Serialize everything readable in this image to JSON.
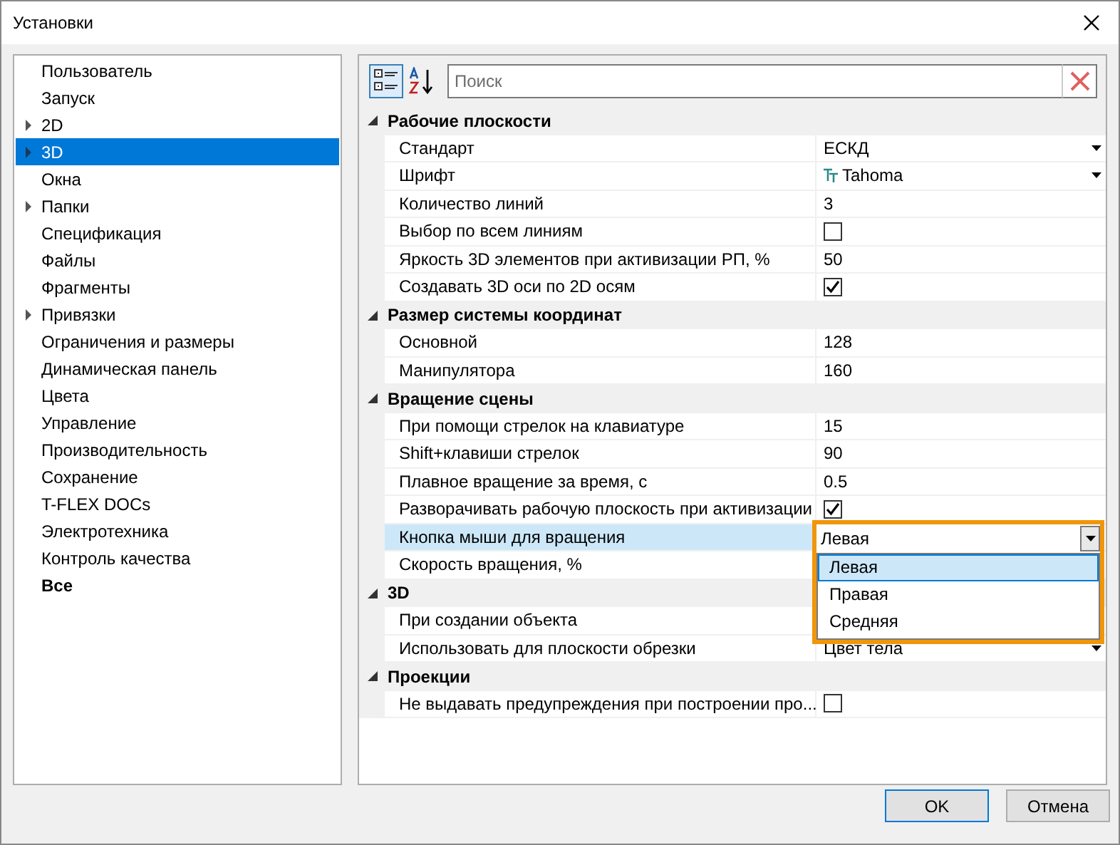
{
  "window": {
    "title": "Установки"
  },
  "tree": [
    {
      "label": "Пользователь",
      "expandable": false,
      "selected": false,
      "bold": false
    },
    {
      "label": "Запуск",
      "expandable": false,
      "selected": false,
      "bold": false
    },
    {
      "label": "2D",
      "expandable": true,
      "selected": false,
      "bold": false
    },
    {
      "label": "3D",
      "expandable": true,
      "selected": true,
      "bold": false
    },
    {
      "label": "Окна",
      "expandable": false,
      "selected": false,
      "bold": false
    },
    {
      "label": "Папки",
      "expandable": true,
      "selected": false,
      "bold": false
    },
    {
      "label": "Спецификация",
      "expandable": false,
      "selected": false,
      "bold": false
    },
    {
      "label": "Файлы",
      "expandable": false,
      "selected": false,
      "bold": false
    },
    {
      "label": "Фрагменты",
      "expandable": false,
      "selected": false,
      "bold": false
    },
    {
      "label": "Привязки",
      "expandable": true,
      "selected": false,
      "bold": false
    },
    {
      "label": "Ограничения и размеры",
      "expandable": false,
      "selected": false,
      "bold": false
    },
    {
      "label": "Динамическая панель",
      "expandable": false,
      "selected": false,
      "bold": false
    },
    {
      "label": "Цвета",
      "expandable": false,
      "selected": false,
      "bold": false
    },
    {
      "label": "Управление",
      "expandable": false,
      "selected": false,
      "bold": false
    },
    {
      "label": "Производительность",
      "expandable": false,
      "selected": false,
      "bold": false
    },
    {
      "label": "Сохранение",
      "expandable": false,
      "selected": false,
      "bold": false
    },
    {
      "label": "T-FLEX DOCs",
      "expandable": false,
      "selected": false,
      "bold": false
    },
    {
      "label": "Электротехника",
      "expandable": false,
      "selected": false,
      "bold": false
    },
    {
      "label": "Контроль качества",
      "expandable": false,
      "selected": false,
      "bold": false
    },
    {
      "label": "Все",
      "expandable": false,
      "selected": false,
      "bold": true
    }
  ],
  "toolbar": [
    {
      "kind": "categorized",
      "selected": true
    },
    {
      "kind": "alphabetical",
      "selected": false
    }
  ],
  "search": {
    "placeholder": "Поиск"
  },
  "groups": [
    {
      "title": "Рабочие плоскости",
      "expanded": true,
      "properties": [
        {
          "label": "Стандарт",
          "kind": "dropdown",
          "value": "ЕСКД"
        },
        {
          "label": "Шрифт",
          "kind": "font",
          "value": "Tahoma"
        },
        {
          "label": "Количество линий",
          "kind": "text",
          "value": "3"
        },
        {
          "label": "Выбор по всем линиям",
          "kind": "checkbox",
          "checked": false
        },
        {
          "label": "Яркость 3D элементов при активизации РП, %",
          "kind": "text",
          "value": "50"
        },
        {
          "label": "Создавать 3D оси по 2D осям",
          "kind": "checkbox",
          "checked": true
        }
      ]
    },
    {
      "title": "Размер системы координат",
      "expanded": true,
      "properties": [
        {
          "label": "Основной",
          "kind": "text",
          "value": "128"
        },
        {
          "label": "Манипулятора",
          "kind": "text",
          "value": "160"
        }
      ]
    },
    {
      "title": "Вращение сцены",
      "expanded": true,
      "properties": [
        {
          "label": "При помощи стрелок на клавиатуре",
          "kind": "text",
          "value": "15"
        },
        {
          "label": "Shift+клавиши стрелок",
          "kind": "text",
          "value": "90"
        },
        {
          "label": "Плавное вращение за время, с",
          "kind": "text",
          "value": "0.5"
        },
        {
          "label": "Разворачивать рабочую плоскость при активизации",
          "kind": "checkbox",
          "checked": true
        },
        {
          "label": "Кнопка мыши для вращения",
          "kind": "open-dropdown",
          "value": "Левая",
          "selected": true,
          "options": [
            {
              "label": "Левая",
              "selected": true
            },
            {
              "label": "Правая",
              "selected": false
            },
            {
              "label": "Средняя",
              "selected": false
            }
          ]
        },
        {
          "label": "Скорость вращения, %",
          "kind": "hidden"
        }
      ]
    },
    {
      "title": "3D",
      "expanded": true,
      "properties": [
        {
          "label": "При создании объекта",
          "kind": "hidden"
        },
        {
          "label": "Использовать для плоскости обрезки",
          "kind": "dropdown",
          "value": "Цвет тела"
        }
      ]
    },
    {
      "title": "Проекции",
      "expanded": true,
      "properties": [
        {
          "label": "Не выдавать предупреждения при построении про...",
          "kind": "checkbox",
          "checked": false
        }
      ]
    }
  ],
  "buttons": [
    {
      "label": "OK",
      "default": true
    },
    {
      "label": "Отмена",
      "default": false
    }
  ]
}
